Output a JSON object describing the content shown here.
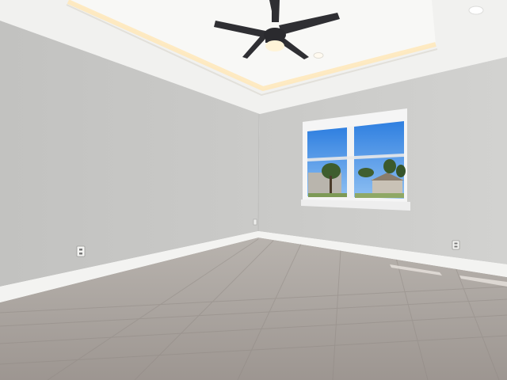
{
  "scene": {
    "subject": "empty-room-interior",
    "colors": {
      "ceiling": "#f3f3f1",
      "tray_ceiling": "#f7f7f5",
      "cove_light": "#fff1cf",
      "left_wall": "#c4c4c2",
      "back_wall": "#cdcdcb",
      "baseboard": "#f2f2f0",
      "floor_near": "#a39c97",
      "floor_far": "#b6b1ac",
      "window_frame": "#f4f4f4",
      "sky": "#3f8ae6",
      "trees": "#3c5a2d",
      "fan_blade": "#2f2f33",
      "fan_light": "#fff6e0"
    },
    "icons": [
      "ceiling-fan-icon",
      "outlet-icon",
      "smoke-detector-icon",
      "recessed-light-icon"
    ]
  }
}
